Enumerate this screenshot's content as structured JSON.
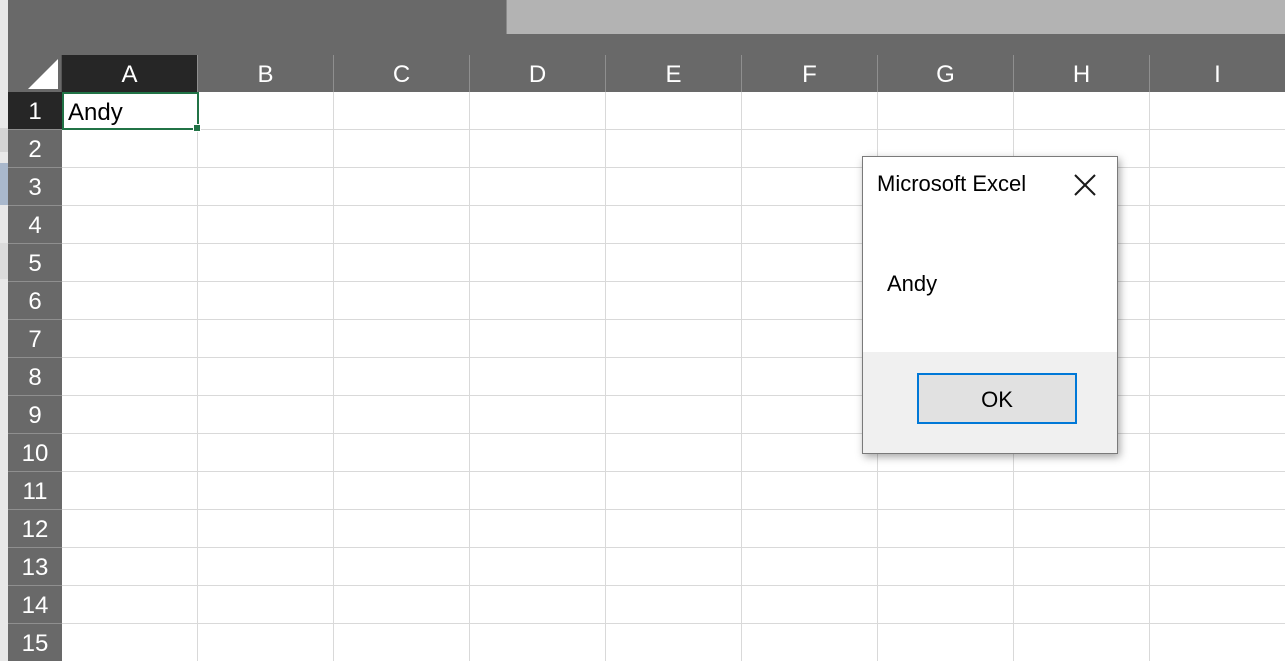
{
  "columns": [
    "A",
    "B",
    "C",
    "D",
    "E",
    "F",
    "G",
    "H",
    "I"
  ],
  "rows": [
    "1",
    "2",
    "3",
    "4",
    "5",
    "6",
    "7",
    "8",
    "9",
    "10",
    "11",
    "12",
    "13",
    "14",
    "15"
  ],
  "active_cell": {
    "column": "A",
    "row": "1",
    "value": "Andy"
  },
  "dialog": {
    "title": "Microsoft Excel",
    "message": "Andy",
    "ok_label": "OK",
    "close_icon": "close-icon"
  },
  "colors": {
    "header_bg": "#696969",
    "active_header_bg": "#262626",
    "selection_border": "#217346",
    "button_focus": "#0078d7"
  }
}
